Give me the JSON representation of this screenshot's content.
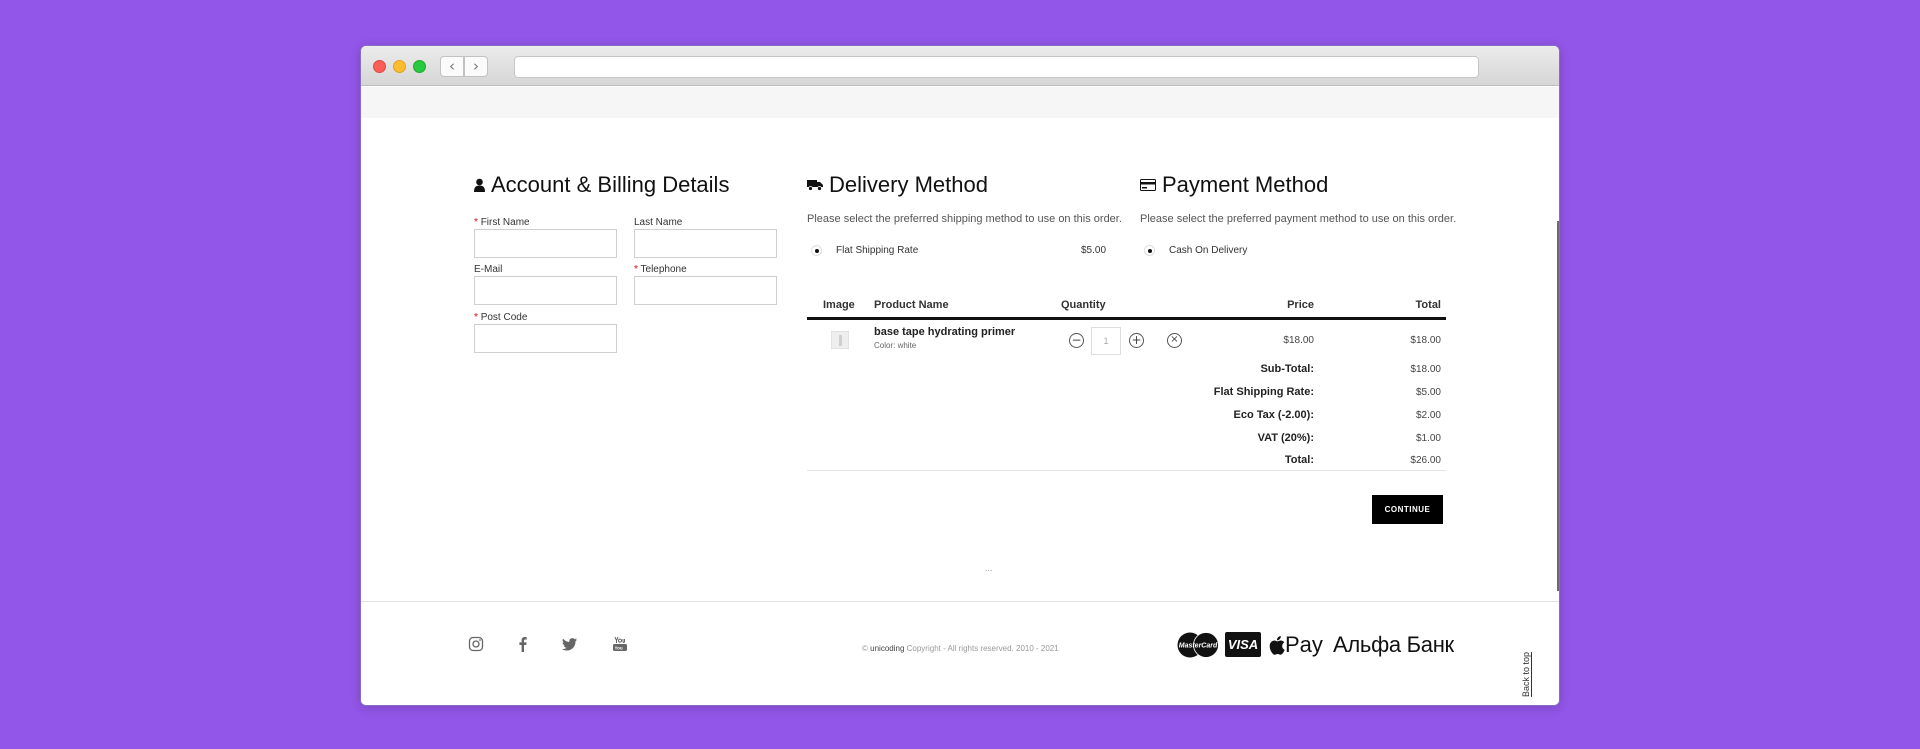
{
  "billing": {
    "title": "Account & Billing Details",
    "first_name_label": "First Name",
    "last_name_label": "Last Name",
    "email_label": "E-Mail",
    "telephone_label": "Telephone",
    "postcode_label": "Post Code",
    "required_mark": "*"
  },
  "delivery": {
    "title": "Delivery Method",
    "note": "Please select the preferred shipping method to use on this order.",
    "option_label": "Flat Shipping Rate",
    "option_price": "$5.00"
  },
  "payment": {
    "title": "Payment Method",
    "note": "Please select the preferred payment method to use on this order.",
    "option_label": "Cash On Delivery"
  },
  "cart": {
    "headers": {
      "image": "Image",
      "product": "Product Name",
      "quantity": "Quantity",
      "price": "Price",
      "total": "Total"
    },
    "item": {
      "name": "base tape hydrating primer",
      "option": "Color: white",
      "quantity": "1",
      "price": "$18.00",
      "total": "$18.00"
    },
    "totals": [
      {
        "label": "Sub-Total:",
        "value": "$18.00"
      },
      {
        "label": "Flat Shipping Rate:",
        "value": "$5.00"
      },
      {
        "label": "Eco Tax (-2.00):",
        "value": "$2.00"
      },
      {
        "label": "VAT (20%):",
        "value": "$1.00"
      },
      {
        "label": "Total:",
        "value": "$26.00"
      }
    ],
    "continue_label": "CONTINUE",
    "dots": "..."
  },
  "footer": {
    "copyright_prefix": "©",
    "brand": "unicoding",
    "copyright_rest": "Copyright - All rights reserved. 2010 - 2021",
    "visa": "VISA",
    "apple_pay": "Pay",
    "alfa": "Альфа Банк",
    "back_to_top": "Back to top",
    "mastercard": "MasterCard"
  },
  "colors": {
    "background": "#9256e8",
    "button": "#000000",
    "required": "#ee0000"
  }
}
